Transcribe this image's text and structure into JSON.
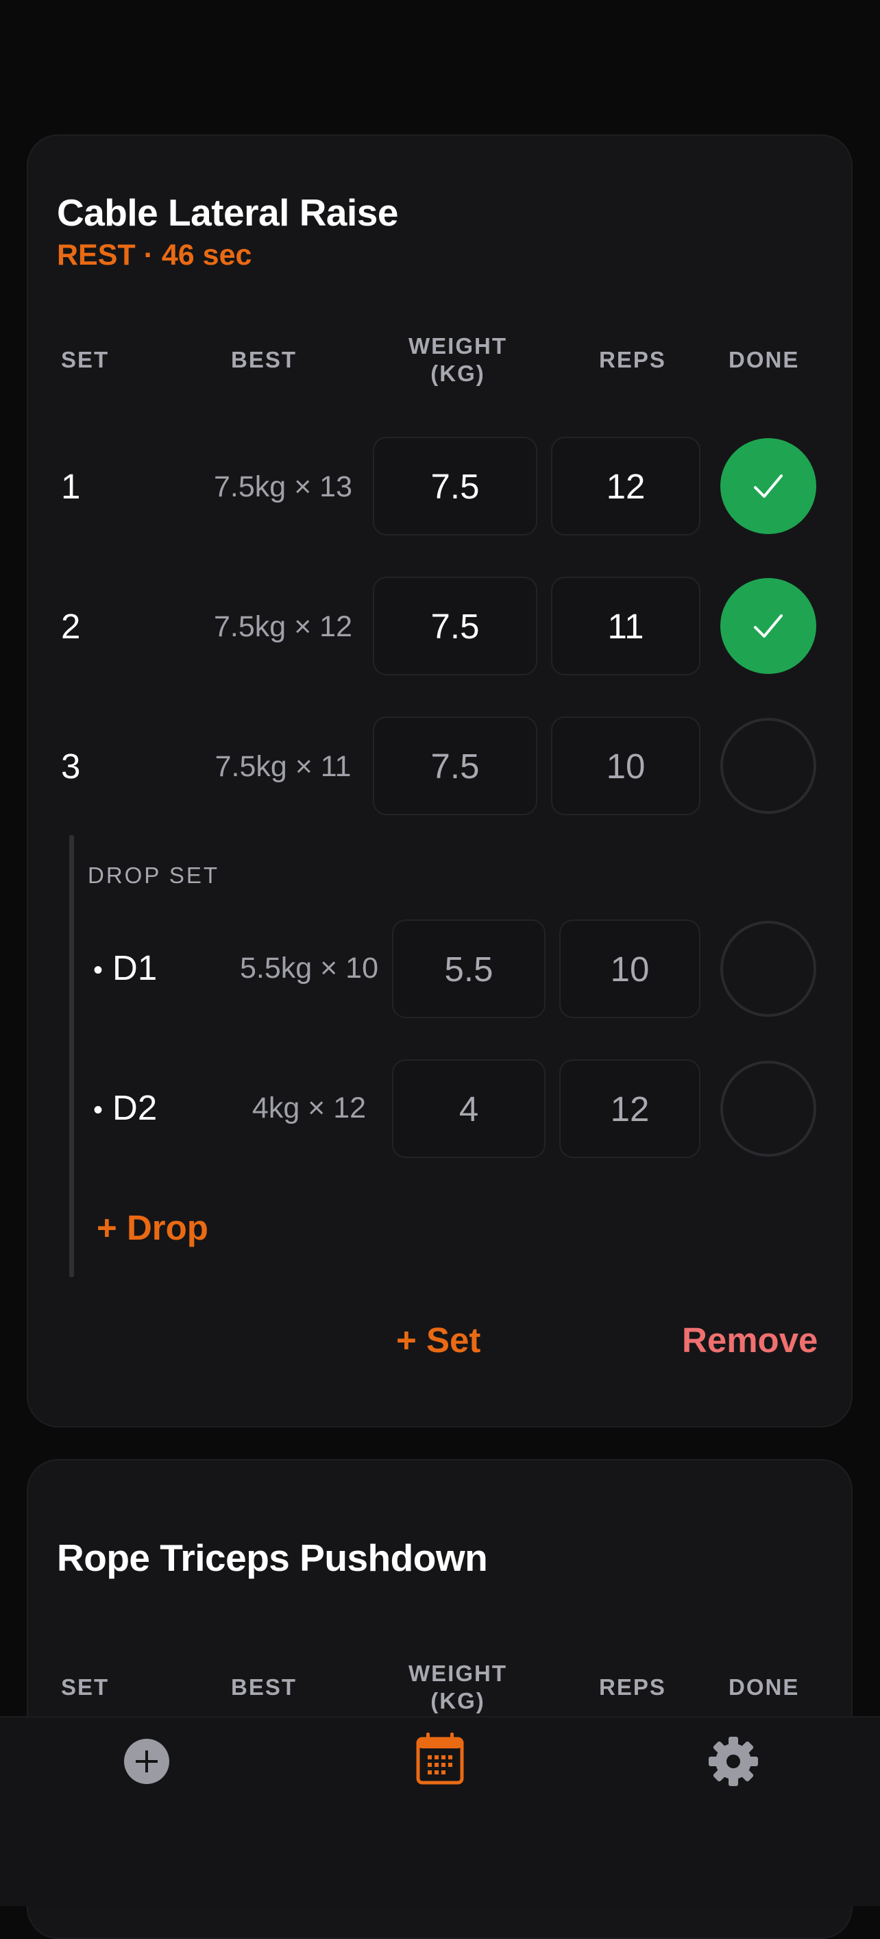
{
  "exercises": [
    {
      "title": "Cable Lateral Raise",
      "rest": "REST · 46 sec",
      "headers": {
        "set": "SET",
        "best": "BEST",
        "weight": "WEIGHT\n(KG)",
        "reps": "REPS",
        "done": "DONE"
      },
      "sets": [
        {
          "num": "1",
          "best": "7.5kg × 13",
          "weight": "7.5",
          "reps": "12",
          "done": true
        },
        {
          "num": "2",
          "best": "7.5kg × 12",
          "weight": "7.5",
          "reps": "11",
          "done": true
        },
        {
          "num": "3",
          "best": "7.5kg × 11",
          "weight": "7.5",
          "reps": "10",
          "done": false
        }
      ],
      "drop_set": {
        "label": "DROP SET",
        "rows": [
          {
            "bullet": "•",
            "num": "D1",
            "best": "5.5kg × 10",
            "weight": "5.5",
            "reps": "10",
            "done": false
          },
          {
            "bullet": "•",
            "num": "D2",
            "best": "4kg × 12",
            "weight": "4",
            "reps": "12",
            "done": false
          }
        ],
        "add_drop_label": "+ Drop"
      },
      "add_set_label": "+ Set",
      "remove_label": "Remove"
    },
    {
      "title": "Rope Triceps Pushdown",
      "headers": {
        "set": "SET",
        "best": "BEST",
        "weight": "WEIGHT\n(KG)",
        "reps": "REPS",
        "done": "DONE"
      }
    }
  ],
  "tabbar": {
    "items": [
      {
        "icon": "add-circle-icon",
        "active": false
      },
      {
        "icon": "calendar-icon",
        "active": true
      },
      {
        "icon": "gear-icon",
        "active": false
      }
    ]
  },
  "colors": {
    "accent": "#ea6a14",
    "done_green": "#1fa552",
    "remove_red": "#f07070",
    "inactive_icon": "#9a9ba3"
  }
}
